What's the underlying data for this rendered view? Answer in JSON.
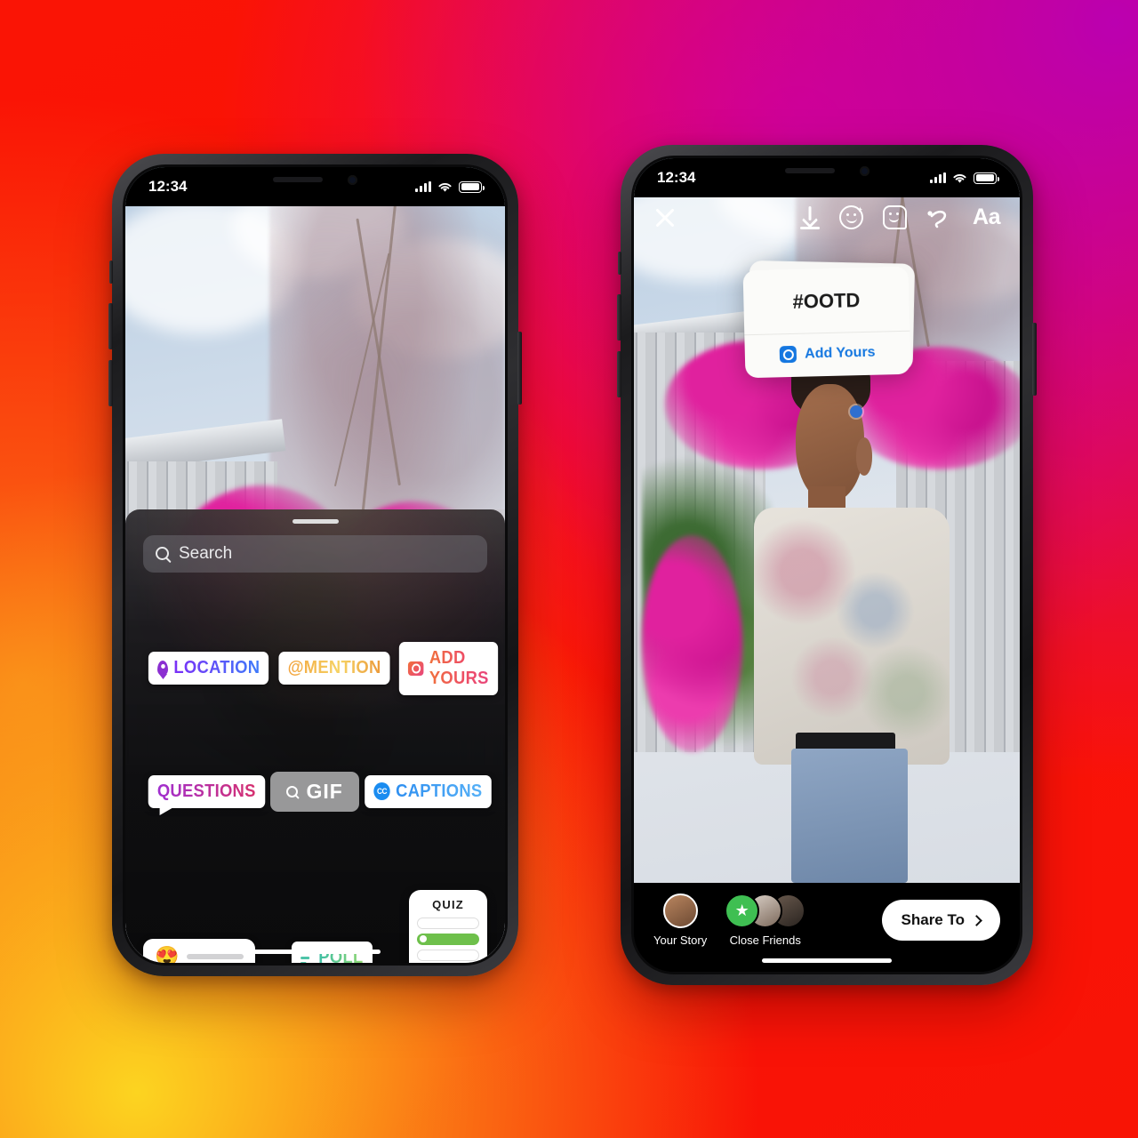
{
  "background": {
    "gradient_colors": [
      "#fa1405",
      "#e6007e",
      "#bb00b0",
      "#f97316",
      "#fcd420"
    ]
  },
  "phones": {
    "left": {
      "status_bar": {
        "time": "12:34",
        "signal_icon": "cellular-bars-icon",
        "wifi_icon": "wifi-icon",
        "battery_icon": "battery-icon"
      },
      "sticker_tray": {
        "grabber": "drag-handle",
        "search": {
          "placeholder": "Search",
          "icon": "search-icon"
        },
        "stickers": [
          {
            "id": "location",
            "label": "LOCATION",
            "icon": "location-pin-icon",
            "text_gradient": [
              "#7b2ff7",
              "#3e7bfa"
            ]
          },
          {
            "id": "mention",
            "label": "@MENTION",
            "icon": "at-symbol",
            "text_gradient": [
              "#f2a23c",
              "#eb9a3a"
            ]
          },
          {
            "id": "add-yours",
            "label": "ADD YOURS",
            "icon": "camera-icon",
            "text_gradient": [
              "#f0713d",
              "#e8467c"
            ]
          },
          {
            "id": "questions",
            "label": "QUESTIONS",
            "icon": "none",
            "text_gradient": [
              "#a02fd0",
              "#d6306e"
            ]
          },
          {
            "id": "gif",
            "label": "GIF",
            "icon": "search-icon",
            "text_gradient": [
              "#ffffff",
              "#ffffff"
            ]
          },
          {
            "id": "captions",
            "label": "CAPTIONS",
            "icon": "closed-caption-icon",
            "text_gradient": [
              "#2f8ff0",
              "#55b0f7"
            ]
          },
          {
            "id": "poll",
            "label": "POLL",
            "icon": "poll-bars-icon",
            "text_gradient": [
              "#3fbfa5",
              "#8fd66f"
            ]
          }
        ],
        "emoji_slider": {
          "emoji": "😍"
        },
        "quiz": {
          "title": "QUIZ",
          "options_count": 3,
          "correct_index": 1,
          "correct_color": "#6ec04b"
        }
      }
    },
    "right": {
      "status_bar": {
        "time": "12:34",
        "signal_icon": "cellular-bars-icon",
        "wifi_icon": "wifi-icon",
        "battery_icon": "battery-icon"
      },
      "toolbar": [
        {
          "id": "close",
          "icon": "close-x-icon"
        },
        {
          "id": "save",
          "icon": "download-icon"
        },
        {
          "id": "effects",
          "icon": "smiley-sparkle-icon"
        },
        {
          "id": "stickers",
          "icon": "sticker-face-icon"
        },
        {
          "id": "draw",
          "icon": "squiggle-draw-icon"
        },
        {
          "id": "text",
          "icon": "text-aa-icon",
          "label": "Aa"
        }
      ],
      "add_yours_sticker": {
        "hashtag": "#OOTD",
        "action_label": "Add Yours",
        "action_icon": "camera-icon",
        "accent_color": "#1577e0"
      },
      "share_bar": {
        "audiences": [
          {
            "id": "your-story",
            "label": "Your Story",
            "avatar": "user-avatar"
          },
          {
            "id": "close-friends",
            "label": "Close Friends",
            "avatar": "close-friends-star",
            "badge_color": "#3fbf52"
          }
        ],
        "share_button": {
          "label": "Share To",
          "icon": "chevron-right-icon"
        }
      }
    }
  }
}
